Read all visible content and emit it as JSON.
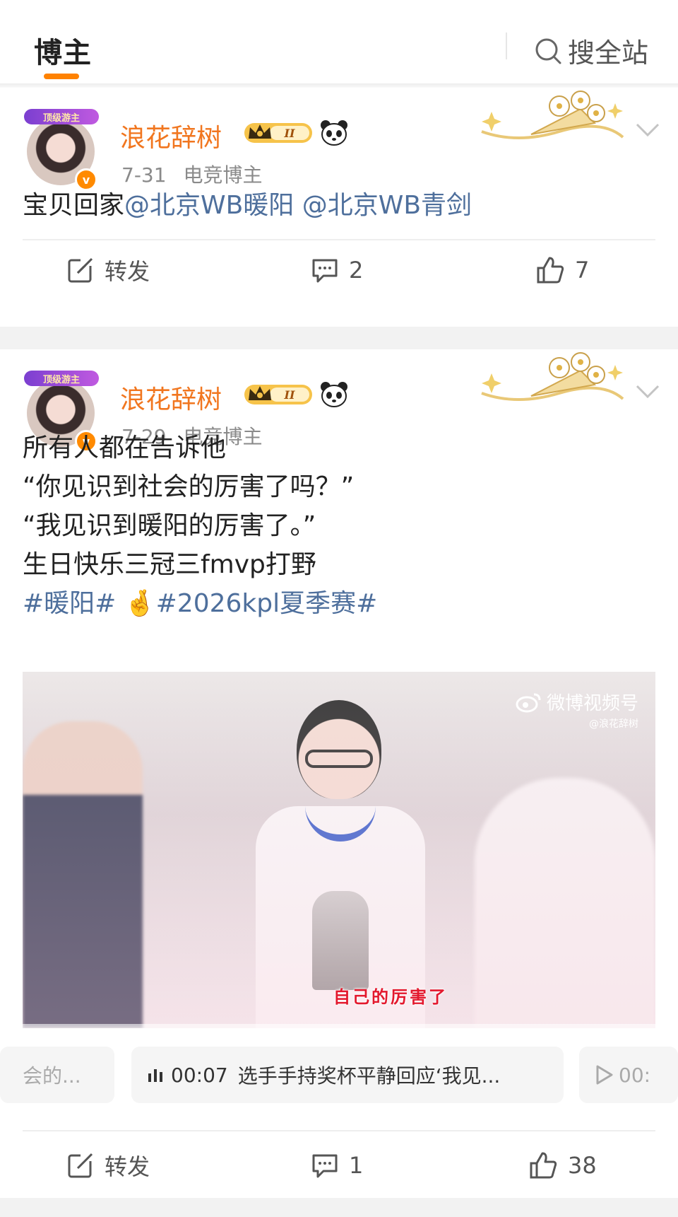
{
  "header": {
    "active_tab": "博主",
    "search_label": "搜全站"
  },
  "posts": [
    {
      "author": "浪花辞树",
      "avatar_frame_text": "顶级游主",
      "rank_badge": "II",
      "date": "7-31",
      "tag": "电竞博主",
      "content_text": "宝贝回家",
      "mentions": [
        "@北京WB暖阳",
        "@北京WB青剑"
      ],
      "actions": {
        "repost_label": "转发",
        "comments": "2",
        "likes": "7"
      }
    },
    {
      "author": "浪花辞树",
      "avatar_frame_text": "顶级游主",
      "rank_badge": "II",
      "date": "7-29",
      "tag": "电竞博主",
      "content_lines": [
        "所有人都在告诉他",
        "“你见识到社会的厉害了吗？”",
        "“我见识到暖阳的厉害了。”",
        "生日快乐三冠三fmvp打野"
      ],
      "hashtags": [
        "#暖阳#",
        "🤞",
        "#2026kpl夏季赛#"
      ],
      "video": {
        "watermark_brand": "微博视频号",
        "watermark_handle": "@浪花辞树",
        "subtitle": "自己的厉害了"
      },
      "chapters": [
        {
          "text": "会的..."
        },
        {
          "time": "00:07",
          "text": "选手手持奖杯平静回应‘我见..."
        },
        {
          "time": "00:"
        }
      ],
      "actions": {
        "repost_label": "转发",
        "comments": "1",
        "likes": "38"
      }
    }
  ]
}
